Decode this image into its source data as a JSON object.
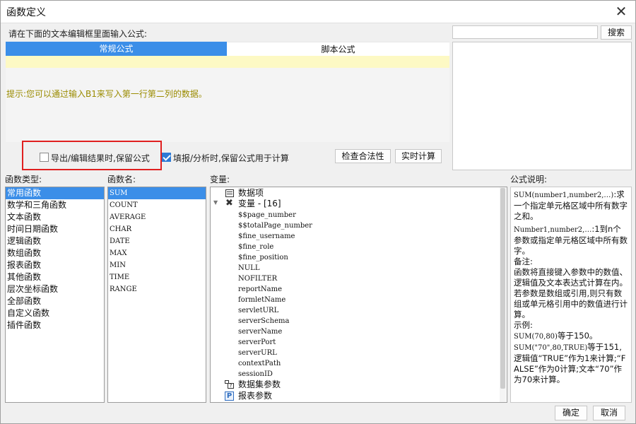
{
  "window": {
    "title": "函数定义",
    "close_label": "✕"
  },
  "prompt_label": "请在下面的文本编辑框里面输入公式:",
  "search": {
    "value": "",
    "button_label": "搜索"
  },
  "tabs": [
    {
      "label": "常规公式",
      "active": true
    },
    {
      "label": "脚本公式",
      "active": false
    }
  ],
  "hint": "提示:您可以通过输入B1来写入第一行第二列的数据。",
  "options": {
    "export_keep_formula": {
      "label": "导出/编辑结果时,保留公式",
      "checked": false
    },
    "fill_keep_formula": {
      "label": "填报/分析时,保留公式用于计算",
      "checked": true
    }
  },
  "buttons": {
    "check_validity": "检查合法性",
    "realtime_calc": "实时计算",
    "ok": "确定",
    "cancel": "取消"
  },
  "function_types": {
    "header": "函数类型:",
    "items": [
      "常用函数",
      "数学和三角函数",
      "文本函数",
      "时间日期函数",
      "逻辑函数",
      "数组函数",
      "报表函数",
      "其他函数",
      "层次坐标函数",
      "全部函数",
      "自定义函数",
      "插件函数"
    ],
    "selected": 0
  },
  "function_names": {
    "header": "函数名:",
    "items": [
      "SUM",
      "COUNT",
      "AVERAGE",
      "CHAR",
      "DATE",
      "MAX",
      "MIN",
      "TIME",
      "RANGE"
    ],
    "selected": 0
  },
  "variables": {
    "header": "变量:",
    "data_item": "数据项",
    "variable_group": "变量 - [16]",
    "items": [
      "$$page_number",
      "$$totalPage_number",
      "$fine_username",
      "$fine_role",
      "$fine_position",
      "NULL",
      "NOFILTER",
      "reportName",
      "formletName",
      "servletURL",
      "serverSchema",
      "serverName",
      "serverPort",
      "serverURL",
      "contextPath",
      "sessionID"
    ],
    "dataset_params": "数据集参数",
    "report_params": "报表参数"
  },
  "description": {
    "header": "公式说明:",
    "l1a": "SUM(number1,number2,…)",
    "l1b": ":求一个指定单元格区域中所有数字之和。",
    "l2a": "Number1,number2,…",
    "l2b": ":1到n个参数或指定单元格区域中所有数字。",
    "l3": "备注:",
    "l4": "函数将直接键入参数中的数值、逻辑值及文本表达式计算在内。若参数是数组或引用,则只有数组或单元格引用中的数值进行计算。",
    "l5": "示例:",
    "l6a": "SUM(70,80)",
    "l6b": "等于150。",
    "l7a": "SUM(\"70\",80,TRUE)",
    "l7b": "等于151,逻辑值“TRUE”作为1来计算;“FALSE”作为0计算;文本“70”作为70来计算。"
  }
}
